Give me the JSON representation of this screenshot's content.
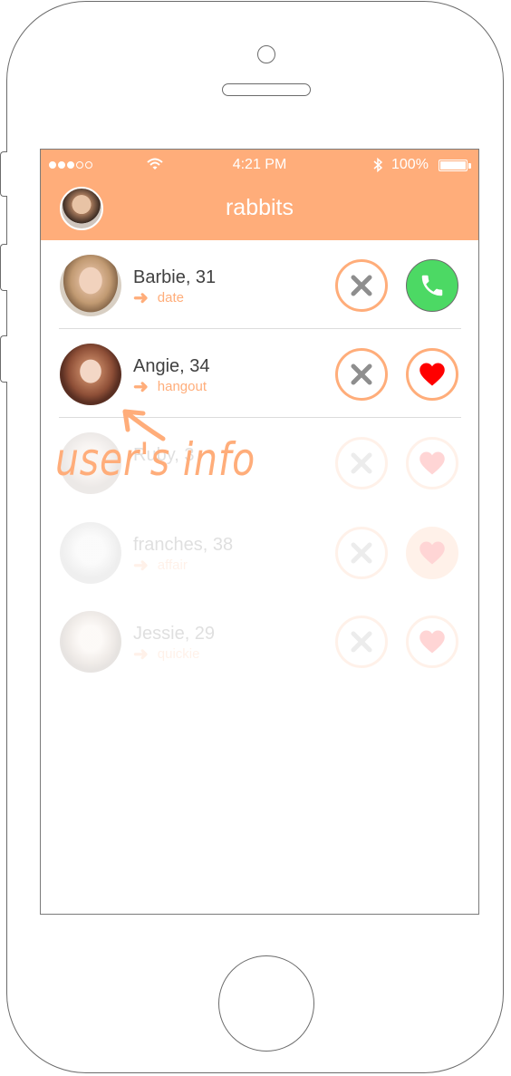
{
  "app": {
    "title": "rabbits"
  },
  "status_bar": {
    "signal_dots": 5,
    "signal_filled": 3,
    "time": "4:21 PM",
    "battery": "100%"
  },
  "colors": {
    "accent": "#ffad7a",
    "call_green": "#4cd964",
    "heart_red": "#ff0000",
    "x_gray": "#8e8e8e"
  },
  "rows": [
    {
      "name": "Barbie, 31",
      "tag": "date",
      "action": "phone-icon",
      "faded": false
    },
    {
      "name": "Angie, 34",
      "tag": "hangout",
      "action": "heart-icon",
      "faded": false
    },
    {
      "name": "Ruby, 3",
      "tag": "",
      "action": "heart-icon",
      "faded": true
    },
    {
      "name": "franches, 38",
      "tag": "affair",
      "action": "heart-icon",
      "faded": true
    },
    {
      "name": "Jessie, 29",
      "tag": "quickie",
      "action": "heart-icon",
      "faded": true
    }
  ],
  "annotation": {
    "label": "user's info"
  }
}
